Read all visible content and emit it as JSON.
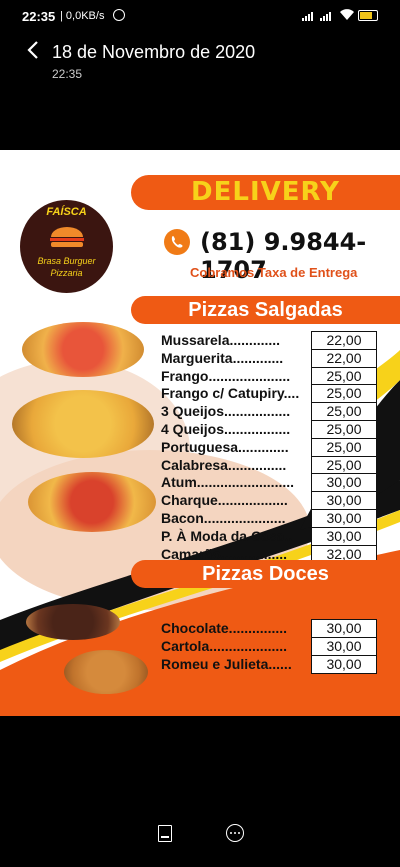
{
  "status_bar": {
    "time": "22:35",
    "network": "0,0KB/s",
    "icons": [
      "alarm-icon",
      "signal-icon",
      "signal-icon",
      "wifi-icon",
      "battery-icon"
    ]
  },
  "header": {
    "title": "18 de Novembro de 2020",
    "subtitle": "22:35"
  },
  "flyer": {
    "logo": {
      "brand": "FAÍSCA",
      "line1": "Brasa Burguer",
      "line2": "Pizzaria"
    },
    "delivery_label": "DELIVERY",
    "phone": "(81) 9.9844-1707",
    "delivery_fee_note": "Cobramos Taxa de Entrega",
    "colors": {
      "accent_orange": "#ef5a14",
      "title_yellow": "#f7d21a"
    },
    "salgadas": {
      "title": "Pizzas Salgadas",
      "items": [
        {
          "name": "Mussarela.............",
          "price": "22,00"
        },
        {
          "name": "Marguerita.............",
          "price": "22,00"
        },
        {
          "name": "Frango.....................",
          "price": "25,00"
        },
        {
          "name": "Frango c/ Catupiry....",
          "price": "25,00"
        },
        {
          "name": "3 Queijos.................",
          "price": "25,00"
        },
        {
          "name": "4 Queijos.................",
          "price": "25,00"
        },
        {
          "name": "Portuguesa.............",
          "price": "25,00"
        },
        {
          "name": "Calabresa...............",
          "price": "25,00"
        },
        {
          "name": "Atum.........................",
          "price": "30,00"
        },
        {
          "name": "Charque..................",
          "price": "30,00"
        },
        {
          "name": "Bacon.....................",
          "price": "30,00"
        },
        {
          "name": "P. À Moda da Casa..",
          "price": "30,00"
        },
        {
          "name": "Camarão.................",
          "price": "32,00"
        }
      ]
    },
    "doces": {
      "title": "Pizzas Doces",
      "items": [
        {
          "name": "Chocolate...............",
          "price": "30,00"
        },
        {
          "name": "Cartola....................",
          "price": "30,00"
        },
        {
          "name": "Romeu e Julieta......",
          "price": "30,00"
        }
      ]
    }
  },
  "bottom_bar": {
    "icons": [
      "document-icon",
      "more-options-icon"
    ]
  }
}
